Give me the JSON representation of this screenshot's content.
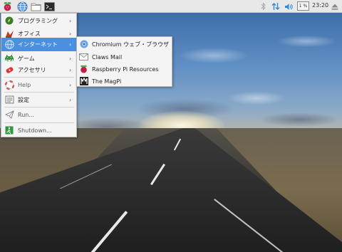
{
  "menu": {
    "items": [
      {
        "label": "プログラミング",
        "has_submenu": true
      },
      {
        "label": "オフィス",
        "has_submenu": true
      },
      {
        "label": "インターネット",
        "has_submenu": true
      },
      {
        "label": "ゲーム",
        "has_submenu": true
      },
      {
        "label": "アクセサリ",
        "has_submenu": true
      },
      {
        "label": "Help",
        "has_submenu": true
      },
      {
        "label": "設定",
        "has_submenu": true
      },
      {
        "label": "Run...",
        "has_submenu": false
      },
      {
        "label": "Shutdown...",
        "has_submenu": false
      }
    ],
    "submenu_arrow": "›",
    "active_item": "インターネット"
  },
  "submenu": {
    "items": [
      {
        "label": "Chromium ウェブ・ブラウザ",
        "icon": "chromium-icon"
      },
      {
        "label": "Claws Mail",
        "icon": "mail-icon"
      },
      {
        "label": "Raspberry Pi Resources",
        "icon": "raspberry-icon"
      },
      {
        "label": "The MagPi",
        "icon": "magpi-icon"
      }
    ]
  },
  "panel": {
    "cpu_usage": "1 %",
    "clock": "23:20",
    "launchers": [
      "raspberry-menu-icon",
      "web-browser-icon",
      "file-manager-icon",
      "terminal-icon"
    ],
    "tray": [
      "bluetooth-icon",
      "network-icon",
      "volume-icon",
      "eject-icon"
    ]
  },
  "colors": {
    "panel_bg": "#e8e8e8",
    "menu_bg": "#f4f4f4",
    "highlight": "#4a8fe0",
    "tray_accent": "#2f8ad8"
  }
}
